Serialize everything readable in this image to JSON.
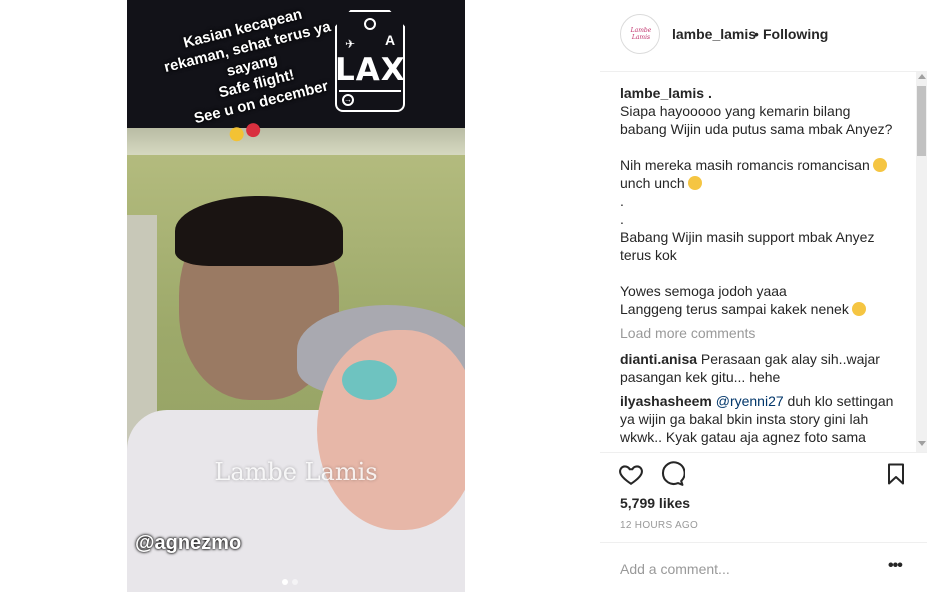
{
  "story": {
    "text_lines": [
      "Kasian kecapean",
      "rekaman, sehat terus ya",
      "sayang",
      "Safe flight!",
      "See u on december"
    ],
    "tag_code": "LAX",
    "tag_letter": "A",
    "watermark": "Lambe Lamis",
    "mention": "@agnezmo",
    "carousel_dots": 2,
    "carousel_active_index": 0
  },
  "header": {
    "avatar_text": "Lambe Lamis",
    "username": "lambe_lamis",
    "separator": "•",
    "follow_state": "Following"
  },
  "caption": {
    "username": "lambe_lamis .",
    "lines": [
      "Siapa hayooooo yang kemarin bilang",
      "babang Wijin uda putus sama mbak Anyez?",
      "",
      "Nih mereka masih romancis romancisan",
      "unch unch",
      ".",
      ".",
      "Babang Wijin masih support mbak Anyez",
      "terus kok",
      "",
      "Yowes semoga jodoh yaaa",
      "Langgeng terus sampai kakek nenek"
    ]
  },
  "load_more": "Load more comments",
  "comments": [
    {
      "user": "dianti.anisa",
      "text": "Perasaan gak alay sih..wajar pasangan kek gitu... hehe"
    },
    {
      "user": "ilyashasheem",
      "mention": "@ryenni27",
      "text": "duh klo settingan ya wijin ga bakal bkin insta story gini lah wkwk.. Kyak gatau aja agnez foto sama"
    }
  ],
  "actions": {
    "like_icon": "heart-icon",
    "comment_icon": "comment-icon",
    "save_icon": "bookmark-icon"
  },
  "likes": "5,799 likes",
  "timestamp": "12 HOURS AGO",
  "add_comment": {
    "placeholder": "Add a comment..."
  },
  "more_label": "•••",
  "colors": {
    "mention": "#003569",
    "muted": "#999999",
    "border": "#efefef"
  }
}
